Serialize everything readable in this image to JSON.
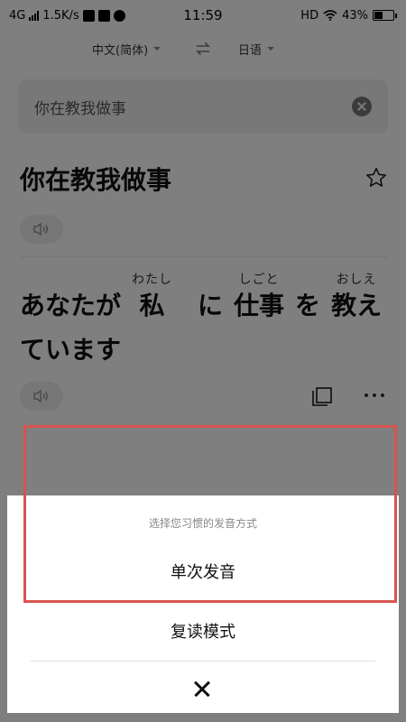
{
  "status_bar": {
    "network": "4G",
    "speed": "1.5K/s",
    "time": "11:59",
    "hd": "HD",
    "battery_percent": "43%",
    "battery_level": 0.43,
    "icons": [
      "signal-icon",
      "screenshot-icon",
      "message-icon",
      "browser-icon",
      "wifi-icon",
      "battery-icon"
    ]
  },
  "language_bar": {
    "source_language": "中文(简体)",
    "target_language": "日语",
    "swap_icon": "swap-arrows-icon"
  },
  "search": {
    "value": "你在教我做事",
    "clear_icon": "clear-icon"
  },
  "source": {
    "text": "你在教我做事",
    "star_icon": "star-outline-icon",
    "speaker_icon": "speaker-icon"
  },
  "result": {
    "segments": [
      {
        "base": "あなたが",
        "ruby": ""
      },
      {
        "base": "私",
        "ruby": "わたし"
      },
      {
        "base": "に",
        "ruby": ""
      },
      {
        "base": "仕事",
        "ruby": "しごと"
      },
      {
        "base": "を",
        "ruby": ""
      },
      {
        "base": "教え",
        "ruby": "おしえ"
      }
    ],
    "line2": "ています",
    "speaker_icon": "speaker-icon",
    "copy_icon": "copy-icon",
    "more_icon": "more-icon"
  },
  "sheet": {
    "title": "选择您习惯的发音方式",
    "option_single": "单次发音",
    "option_repeat": "复读模式",
    "close_icon": "close-icon"
  },
  "colors": {
    "highlight": "#d9534f",
    "overlay": "rgba(0,0,0,0.5)"
  }
}
